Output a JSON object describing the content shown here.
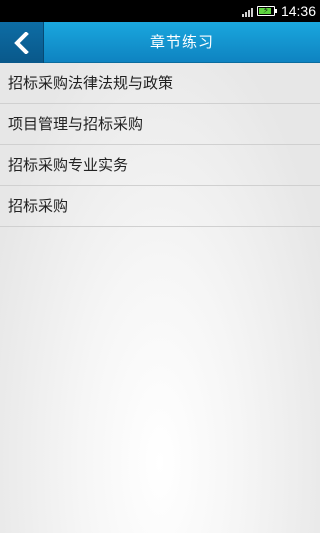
{
  "status_bar": {
    "time": "14:36",
    "icons": [
      "signal-icon",
      "battery-charging-icon"
    ],
    "battery_level": 0.85
  },
  "header": {
    "title": "章节练习",
    "back_icon": "chevron-left-icon"
  },
  "list": {
    "items": [
      {
        "label": "招标采购法律法规与政策"
      },
      {
        "label": "项目管理与招标采购"
      },
      {
        "label": "招标采购专业实务"
      },
      {
        "label": "招标采购"
      }
    ]
  },
  "colors": {
    "header_accent": "#1aa7de",
    "back_button": "#0d6da5",
    "battery_fill": "#5ed53f"
  }
}
